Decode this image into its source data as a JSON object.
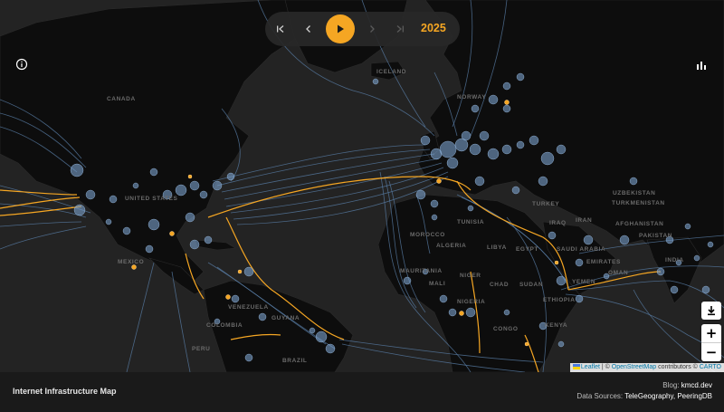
{
  "player": {
    "year": "2025",
    "buttons": [
      "first-icon",
      "prev-icon",
      "play-icon",
      "next-icon",
      "last-icon"
    ]
  },
  "map": {
    "country_labels": [
      {
        "text": "ICELAND",
        "key": "iceland"
      },
      {
        "text": "CANADA",
        "key": "canada"
      },
      {
        "text": "NORWAY",
        "key": "norway"
      },
      {
        "text": "UNITED STATES",
        "key": "united-states"
      },
      {
        "text": "MEXICO",
        "key": "mexico"
      },
      {
        "text": "TURKEY",
        "key": "turkey"
      },
      {
        "text": "UZBEKISTAN",
        "key": "uzbekistan"
      },
      {
        "text": "TURKMENISTAN",
        "key": "turkmenistan"
      },
      {
        "text": "AFGHANISTAN",
        "key": "afghanistan"
      },
      {
        "text": "PAKISTAN",
        "key": "pakistan"
      },
      {
        "text": "INDIA",
        "key": "india"
      },
      {
        "text": "IRAN",
        "key": "iran"
      },
      {
        "text": "IRAQ",
        "key": "iraq"
      },
      {
        "text": "TUNISIA",
        "key": "tunisia"
      },
      {
        "text": "MOROCCO",
        "key": "morocco"
      },
      {
        "text": "ALGERIA",
        "key": "algeria"
      },
      {
        "text": "LIBYA",
        "key": "libya"
      },
      {
        "text": "EGYPT",
        "key": "egypt"
      },
      {
        "text": "SAUDI ARABIA",
        "key": "saudi-arabia"
      },
      {
        "text": "EMIRATES",
        "key": "emirates"
      },
      {
        "text": "OMAN",
        "key": "oman"
      },
      {
        "text": "YEMEN",
        "key": "yemen"
      },
      {
        "text": "MAURITANIA",
        "key": "mauritania"
      },
      {
        "text": "MALI",
        "key": "mali"
      },
      {
        "text": "NIGER",
        "key": "niger"
      },
      {
        "text": "CHAD",
        "key": "chad"
      },
      {
        "text": "SUDAN",
        "key": "sudan"
      },
      {
        "text": "ETHIOPIA",
        "key": "ethiopia"
      },
      {
        "text": "NIGERIA",
        "key": "nigeria"
      },
      {
        "text": "KENYA",
        "key": "kenya"
      },
      {
        "text": "CONGO",
        "key": "congo"
      },
      {
        "text": "VENEZUELA",
        "key": "venezuela"
      },
      {
        "text": "GUYANA",
        "key": "guyana"
      },
      {
        "text": "COLOMBIA",
        "key": "colombia"
      },
      {
        "text": "PERU",
        "key": "peru"
      },
      {
        "text": "BRAZIL",
        "key": "brazil"
      }
    ],
    "colors": {
      "background": "#232323",
      "land": "#0d0d0d",
      "cable": "#5a7fa8",
      "node": "#7aa0cc",
      "new_cable": "#f5a623"
    }
  },
  "controls": {
    "download_icon": "download-icon",
    "zoom_in": "+",
    "zoom_out": "−",
    "info_icon": "info-icon",
    "chart_icon": "bar-chart-icon"
  },
  "attribution": {
    "leaflet": "Leaflet",
    "sep": " | © ",
    "osm": "OpenStreetMap",
    "contributors": " contributors © ",
    "carto": "CARTO"
  },
  "footer": {
    "title": "Internet Infrastructure Map",
    "blog_label": "Blog: ",
    "blog_value": "kmcd.dev",
    "sources_label": "Data Sources: ",
    "sources_value": "TeleGeography, PeeringDB"
  }
}
